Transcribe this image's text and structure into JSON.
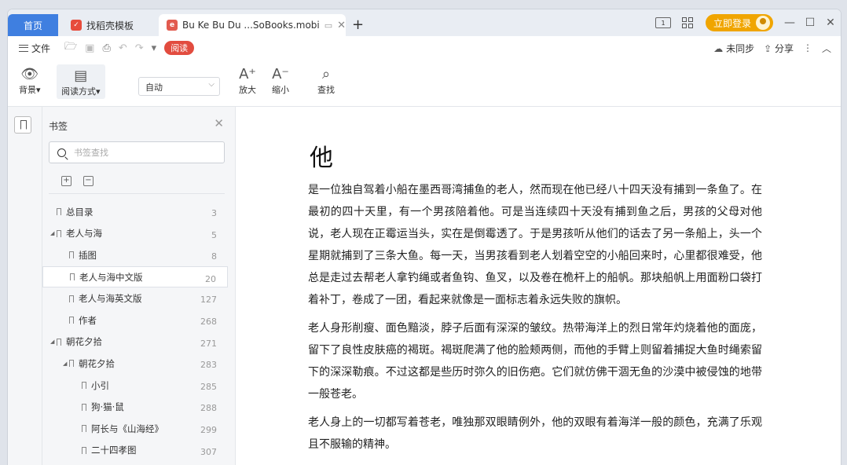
{
  "tabs": {
    "home": "首页",
    "template": "找稻壳模板",
    "active": "Bu Ke Bu Du ...SoBooks.mobi"
  },
  "titlebar": {
    "login": "立即登录"
  },
  "menubar": {
    "file": "文件",
    "read": "阅读",
    "sync": "未同步",
    "share": "分享"
  },
  "ribbon": {
    "background": "背景",
    "read_mode": "阅读方式",
    "auto": "自动",
    "zoom_in": "放大",
    "zoom_out": "缩小",
    "find": "查找"
  },
  "panel": {
    "title": "书签",
    "search_placeholder": "书签查找"
  },
  "toc": [
    {
      "title": "总目录",
      "page": "3",
      "level": 0,
      "expandable": false
    },
    {
      "title": "老人与海",
      "page": "5",
      "level": 0,
      "expandable": true
    },
    {
      "title": "插图",
      "page": "8",
      "level": 1,
      "expandable": false
    },
    {
      "title": "老人与海中文版",
      "page": "20",
      "level": 1,
      "expandable": false,
      "selected": true
    },
    {
      "title": "老人与海英文版",
      "page": "127",
      "level": 1,
      "expandable": false
    },
    {
      "title": "作者",
      "page": "268",
      "level": 1,
      "expandable": false
    },
    {
      "title": "朝花夕拾",
      "page": "271",
      "level": 0,
      "expandable": true
    },
    {
      "title": "朝花夕拾",
      "page": "283",
      "level": 1,
      "expandable": true
    },
    {
      "title": "小引",
      "page": "285",
      "level": 2,
      "expandable": false
    },
    {
      "title": "狗·猫·鼠",
      "page": "288",
      "level": 2,
      "expandable": false
    },
    {
      "title": "阿长与《山海经》",
      "page": "299",
      "level": 2,
      "expandable": false
    },
    {
      "title": "二十四孝图",
      "page": "307",
      "level": 2,
      "expandable": false
    }
  ],
  "content": {
    "chapter_title": "他",
    "paragraphs": [
      "是一位独自驾着小船在墨西哥湾捕鱼的老人，然而现在他已经八十四天没有捕到一条鱼了。在最初的四十天里，有一个男孩陪着他。可是当连续四十天没有捕到鱼之后，男孩的父母对他说，老人现在正霉运当头，实在是倒霉透了。于是男孩听从他们的话去了另一条船上，头一个星期就捕到了三条大鱼。每一天，当男孩看到老人划着空空的小船回来时，心里都很难受，他总是走过去帮老人拿钓绳或者鱼钩、鱼叉，以及卷在桅杆上的船帆。那块船帆上用面粉口袋打着补丁，卷成了一团，看起来就像是一面标志着永远失败的旗帜。",
      "老人身形削瘦、面色黯淡，脖子后面有深深的皱纹。热带海洋上的烈日常年灼烧着他的面庞，留下了良性皮肤癌的褐斑。褐斑爬满了他的脸颊两侧，而他的手臂上则留着捕捉大鱼时绳索留下的深深勒痕。不过这都是些历时弥久的旧伤疤。它们就仿佛干涸无鱼的沙漠中被侵蚀的地带一般苍老。",
      "老人身上的一切都写着苍老，唯独那双眼睛例外，他的双眼有着海洋一般的颜色，充满了乐观且不服输的精神。"
    ]
  }
}
